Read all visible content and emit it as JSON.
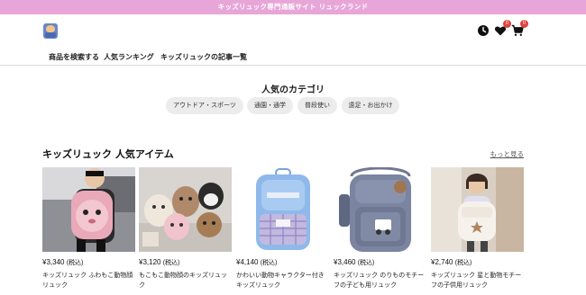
{
  "banner": {
    "text": "キッズリュック専門通販サイト リュックランド"
  },
  "header": {
    "icons": [
      "logo-icon",
      "history-icon",
      "heart-icon",
      "cart-icon"
    ],
    "favorites_count": "0",
    "cart_count": "0"
  },
  "nav": {
    "items": [
      {
        "label": "商品を検索する"
      },
      {
        "label": "人気ランキング"
      },
      {
        "label": "キッズリュックの記事一覧"
      }
    ]
  },
  "categories": {
    "title": "人気のカテゴリ",
    "items": [
      {
        "label": "アウトドア・スポーツ"
      },
      {
        "label": "通園・通学"
      },
      {
        "label": "普段使い"
      },
      {
        "label": "遠足・お出かけ"
      }
    ]
  },
  "popular": {
    "title": "キッズリュック 人気アイテム",
    "more_label": "もっと見る",
    "products": [
      {
        "price": "¥3,340",
        "tax": "(税込)",
        "name": "キッズリュック ふわもこ動物顔リュック"
      },
      {
        "price": "¥3,120",
        "tax": "(税込)",
        "name": "もこもこ動物顔のキッズリュック"
      },
      {
        "price": "¥4,140",
        "tax": "(税込)",
        "name": "かわいい動物キャラクター付きキッズリュック"
      },
      {
        "price": "¥3,460",
        "tax": "(税込)",
        "name": "キッズリュック のりものモチーフの子ども用リュック"
      },
      {
        "price": "¥2,740",
        "tax": "(税込)",
        "name": "キッズリュック 星と動物モチーフの子供用リュック"
      }
    ]
  },
  "colors": {
    "banner": "#e7a6d7",
    "pill": "#ececec",
    "badge": "#e0423b"
  }
}
